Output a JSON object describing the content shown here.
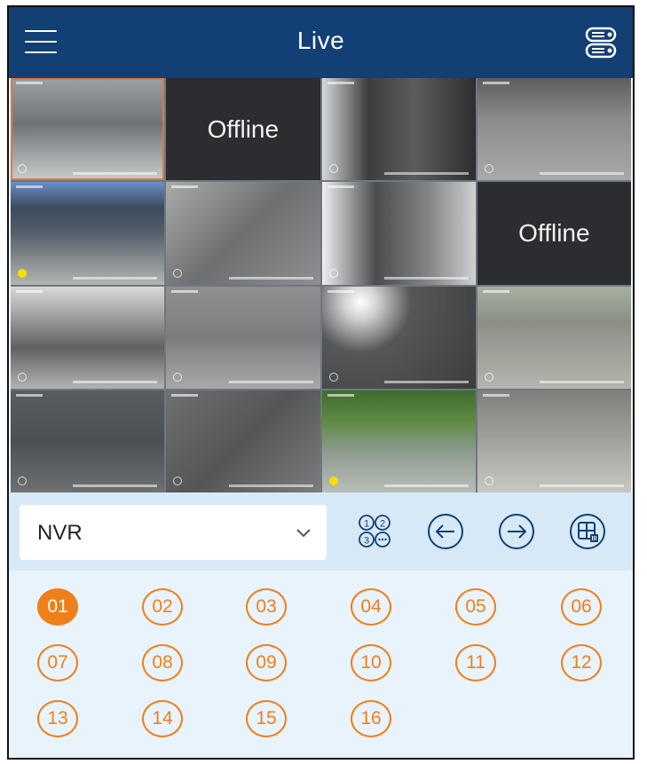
{
  "header": {
    "title": "Live",
    "menu_icon": "hamburger-menu-icon",
    "device_list_icon": "device-list-icon"
  },
  "colors": {
    "header_bg": "#123f74",
    "accent": "#f07f1a",
    "panel_bg": "#d7e9f7",
    "channel_bg": "#e8f3fb"
  },
  "live_grid": {
    "tiles": [
      {
        "id": 1,
        "status": "online"
      },
      {
        "id": 2,
        "status": "offline",
        "text": "Offline"
      },
      {
        "id": 3,
        "status": "online"
      },
      {
        "id": 4,
        "status": "online"
      },
      {
        "id": 5,
        "status": "online"
      },
      {
        "id": 6,
        "status": "online"
      },
      {
        "id": 7,
        "status": "online"
      },
      {
        "id": 8,
        "status": "offline",
        "text": "Offline"
      },
      {
        "id": 9,
        "status": "online"
      },
      {
        "id": 10,
        "status": "online"
      },
      {
        "id": 11,
        "status": "online"
      },
      {
        "id": 12,
        "status": "online"
      },
      {
        "id": 13,
        "status": "online"
      },
      {
        "id": 14,
        "status": "online"
      },
      {
        "id": 15,
        "status": "online"
      },
      {
        "id": 16,
        "status": "online"
      }
    ]
  },
  "controls": {
    "device_select": {
      "value": "NVR"
    },
    "icons": [
      "channel-layout-icon",
      "previous-page-icon",
      "next-page-icon",
      "split-screen-icon"
    ]
  },
  "channels": {
    "items": [
      "01",
      "02",
      "03",
      "04",
      "05",
      "06",
      "07",
      "08",
      "09",
      "10",
      "11",
      "12",
      "13",
      "14",
      "15",
      "16"
    ],
    "active": "01"
  }
}
